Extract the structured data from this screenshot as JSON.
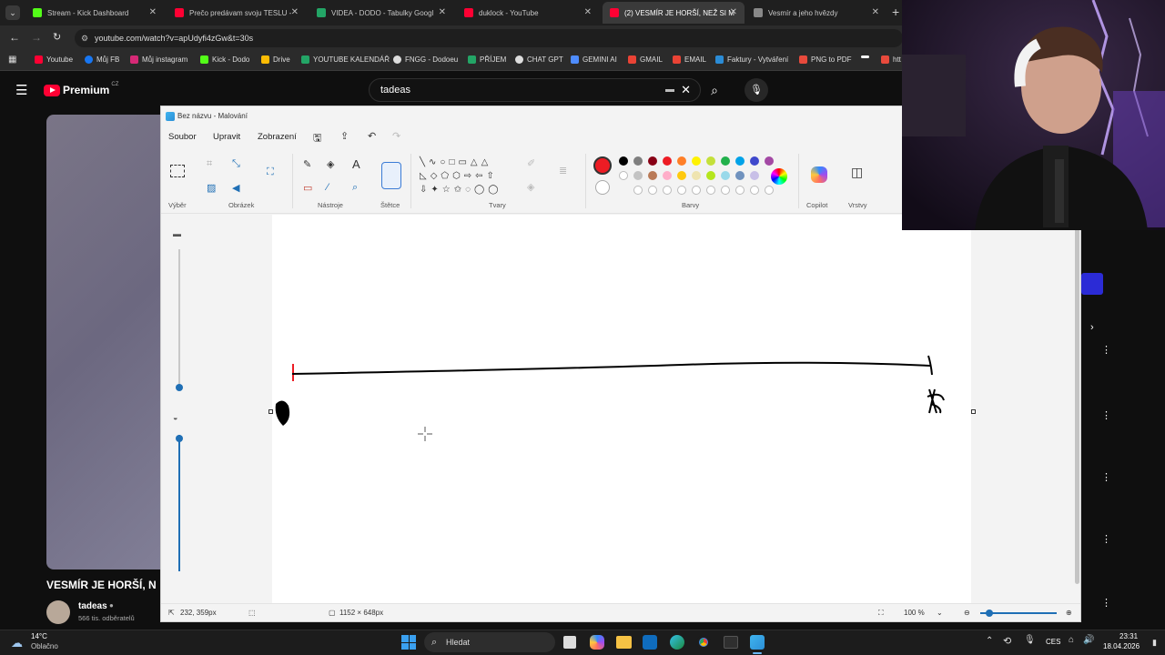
{
  "browser": {
    "tabs": [
      {
        "title": "Stream - Kick Dashboard",
        "color": "#53fc18"
      },
      {
        "title": "Prečo predávam svoju TESLU - ",
        "color": "#ff0033"
      },
      {
        "title": "VIDEA - DODO - Tabulky Googl",
        "color": "#23a566"
      },
      {
        "title": "duklock - YouTube",
        "color": "#ff0033"
      },
      {
        "title": "(2) VESMÍR JE HORŠÍ, NEŽ SI M",
        "color": "#ff0033"
      },
      {
        "title": "Vesmír a jeho hvězdy",
        "color": "#888888"
      }
    ],
    "url": "youtube.com/watch?v=apUdyfi4zGw&t=30s",
    "bookmarks": [
      {
        "label": "Youtube",
        "color": "#ff0033"
      },
      {
        "label": "Můj FB",
        "color": "#1877f2"
      },
      {
        "label": "Můj instagram",
        "color": "#d62976"
      },
      {
        "label": "Kick - Dodo",
        "color": "#53fc18"
      },
      {
        "label": "Drive",
        "color": "#fbbc04"
      },
      {
        "label": "YOUTUBE KALENDÁŘ",
        "color": "#23a566"
      },
      {
        "label": "FNGG - Dodoeu",
        "color": "#dddddd"
      },
      {
        "label": "PŘÍJEM",
        "color": "#23a566"
      },
      {
        "label": "CHAT GPT",
        "color": "#dddddd"
      },
      {
        "label": "GEMINI AI",
        "color": "#4e8cff"
      },
      {
        "label": "GMAIL",
        "color": "#ea4335"
      },
      {
        "label": "EMAIL",
        "color": "#ea4335"
      },
      {
        "label": "Faktury - Vytváření",
        "color": "#2b8cd6"
      },
      {
        "label": "PNG to PDF",
        "color": "#e84a3c"
      },
      {
        "label": "",
        "color": "#ffffff"
      },
      {
        "label": "htt",
        "color": "#e84a3c"
      }
    ]
  },
  "youtube": {
    "logo_text": "Premium",
    "region": "CZ",
    "search_value": "tadeas",
    "video_title": "VESMÍR JE HORŠÍ, N",
    "channel_name": "tadeas",
    "subscribers": "566 tis. odběratelů"
  },
  "paint": {
    "title": "Bez názvu - Malování",
    "menu": [
      "Soubor",
      "Upravit",
      "Zobrazení"
    ],
    "groups": {
      "select": "Výběr",
      "image": "Obrázek",
      "tools": "Nástroje",
      "brushes": "Štětce",
      "shapes": "Tvary",
      "colors": "Barvy",
      "copilot": "Copilot",
      "layers": "Vrstvy"
    },
    "palette_row1": [
      "#000000",
      "#7f7f7f",
      "#880015",
      "#ed1c24",
      "#ff7f27",
      "#fff200",
      "#c4e03a",
      "#22b14c",
      "#00a2e8",
      "#3f48cc",
      "#a349a4"
    ],
    "palette_row2": [
      "#ffffff",
      "#c3c3c3",
      "#b97a57",
      "#ffaec9",
      "#ffc90e",
      "#efe4b0",
      "#b5e61d",
      "#99d9ea",
      "#7092be",
      "#c8bfe7"
    ],
    "active_color": "#ed1c24",
    "status": {
      "cursor_pos": "232, 359px",
      "canvas_size": "1152 × 648px",
      "zoom": "100 %"
    }
  },
  "taskbar": {
    "weather_temp": "14°C",
    "weather_desc": "Oblačno",
    "search_placeholder": "Hledat",
    "language": "CES",
    "time": "23:31",
    "date": "18.04.2026"
  }
}
